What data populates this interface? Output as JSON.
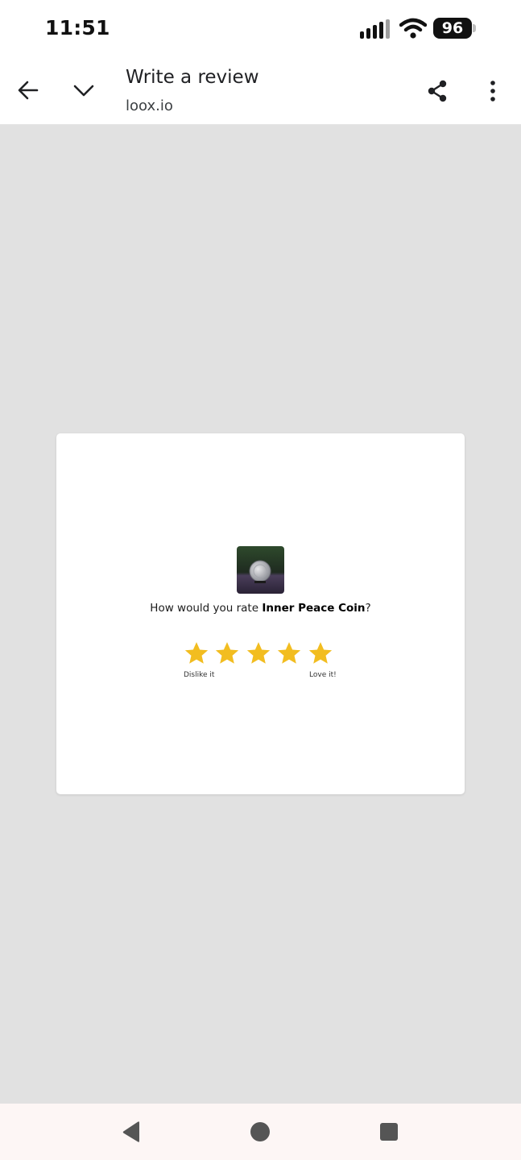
{
  "status_bar": {
    "time": "11:51",
    "battery": "96",
    "icons": [
      "signal-icon",
      "wifi-icon",
      "battery-icon"
    ]
  },
  "toolbar": {
    "title": "Write a review",
    "url": "loox.io",
    "icons": {
      "back": "arrow-left-icon",
      "collapse": "chevron-down-icon",
      "share": "share-icon",
      "more": "more-vertical-icon"
    }
  },
  "review": {
    "question_prefix": "How would you rate ",
    "product_name": "Inner Peace Coin",
    "question_suffix": "?",
    "star_count": 5,
    "star_color": "#f2bd20",
    "scale_low": "Dislike it",
    "scale_high": "Love it!"
  },
  "nav_bar": {
    "icons": [
      "nav-back-icon",
      "nav-home-icon",
      "nav-recents-icon"
    ]
  },
  "colors": {
    "page_background": "#e1e1e1",
    "card_background": "#ffffff",
    "star": "#f2bd20",
    "nav_bar_background": "#fdf6f5"
  }
}
